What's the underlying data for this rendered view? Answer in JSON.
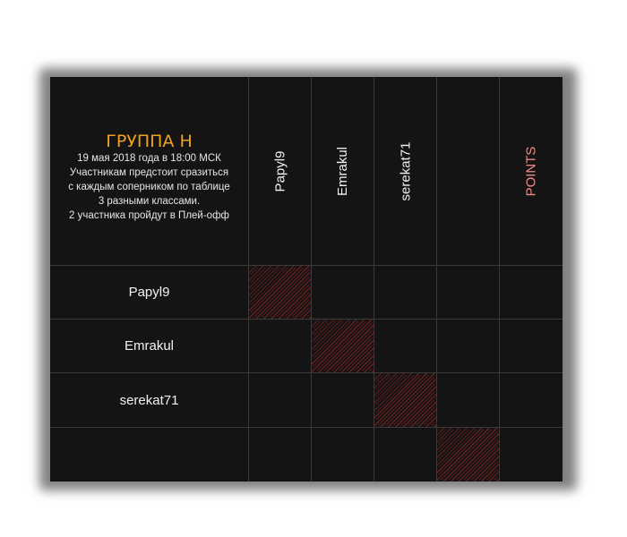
{
  "header": {
    "title": "ГРУППА Н",
    "lines": [
      "19 мая 2018 года в 18:00 МСК",
      "Участникам предстоит сразиться",
      "с каждым соперником по таблице",
      "3 разными классами.",
      "2 участника пройдут в Плей-офф"
    ]
  },
  "columns": [
    "Papyl9",
    "Emrakul",
    "serekat71",
    "",
    "POINTS"
  ],
  "rows": [
    "Papyl9",
    "Emrakul",
    "serekat71",
    ""
  ],
  "colors": {
    "title": "#f0a020",
    "points": "#f08a8a",
    "background": "#141414",
    "hatch": "#7a1f1f"
  }
}
